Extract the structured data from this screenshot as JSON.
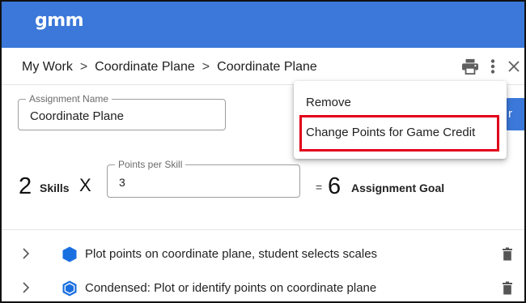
{
  "app": {
    "logo_text": "gmm",
    "brand_color": "#3b78d9"
  },
  "breadcrumb": {
    "items": [
      "My Work",
      "Coordinate Plane",
      "Coordinate Plane"
    ],
    "separator": ">"
  },
  "toolbar": {
    "print_icon": "print-icon",
    "more_icon": "more-vert-icon",
    "close_icon": "close-icon"
  },
  "assignment": {
    "name_label": "Assignment Name",
    "name_value": "Coordinate Plane"
  },
  "goal": {
    "skills_count": "2",
    "skills_label": "Skills",
    "times_symbol": "X",
    "points_label": "Points per Skill",
    "points_value": "3",
    "equals_symbol": "=",
    "goal_value": "6",
    "goal_label": "Assignment Goal"
  },
  "menu": {
    "items": [
      {
        "label": "Remove"
      },
      {
        "label": "Change Points for Game Credit",
        "highlighted": true
      }
    ],
    "highlight_color": "#e1001a"
  },
  "skills": [
    {
      "label": "Plot points on coordinate plane, student selects scales",
      "icon": "hexagon-solid-icon"
    },
    {
      "label": "Condensed: Plot or identify points on coordinate plane",
      "icon": "hexagon-outline-icon"
    }
  ]
}
